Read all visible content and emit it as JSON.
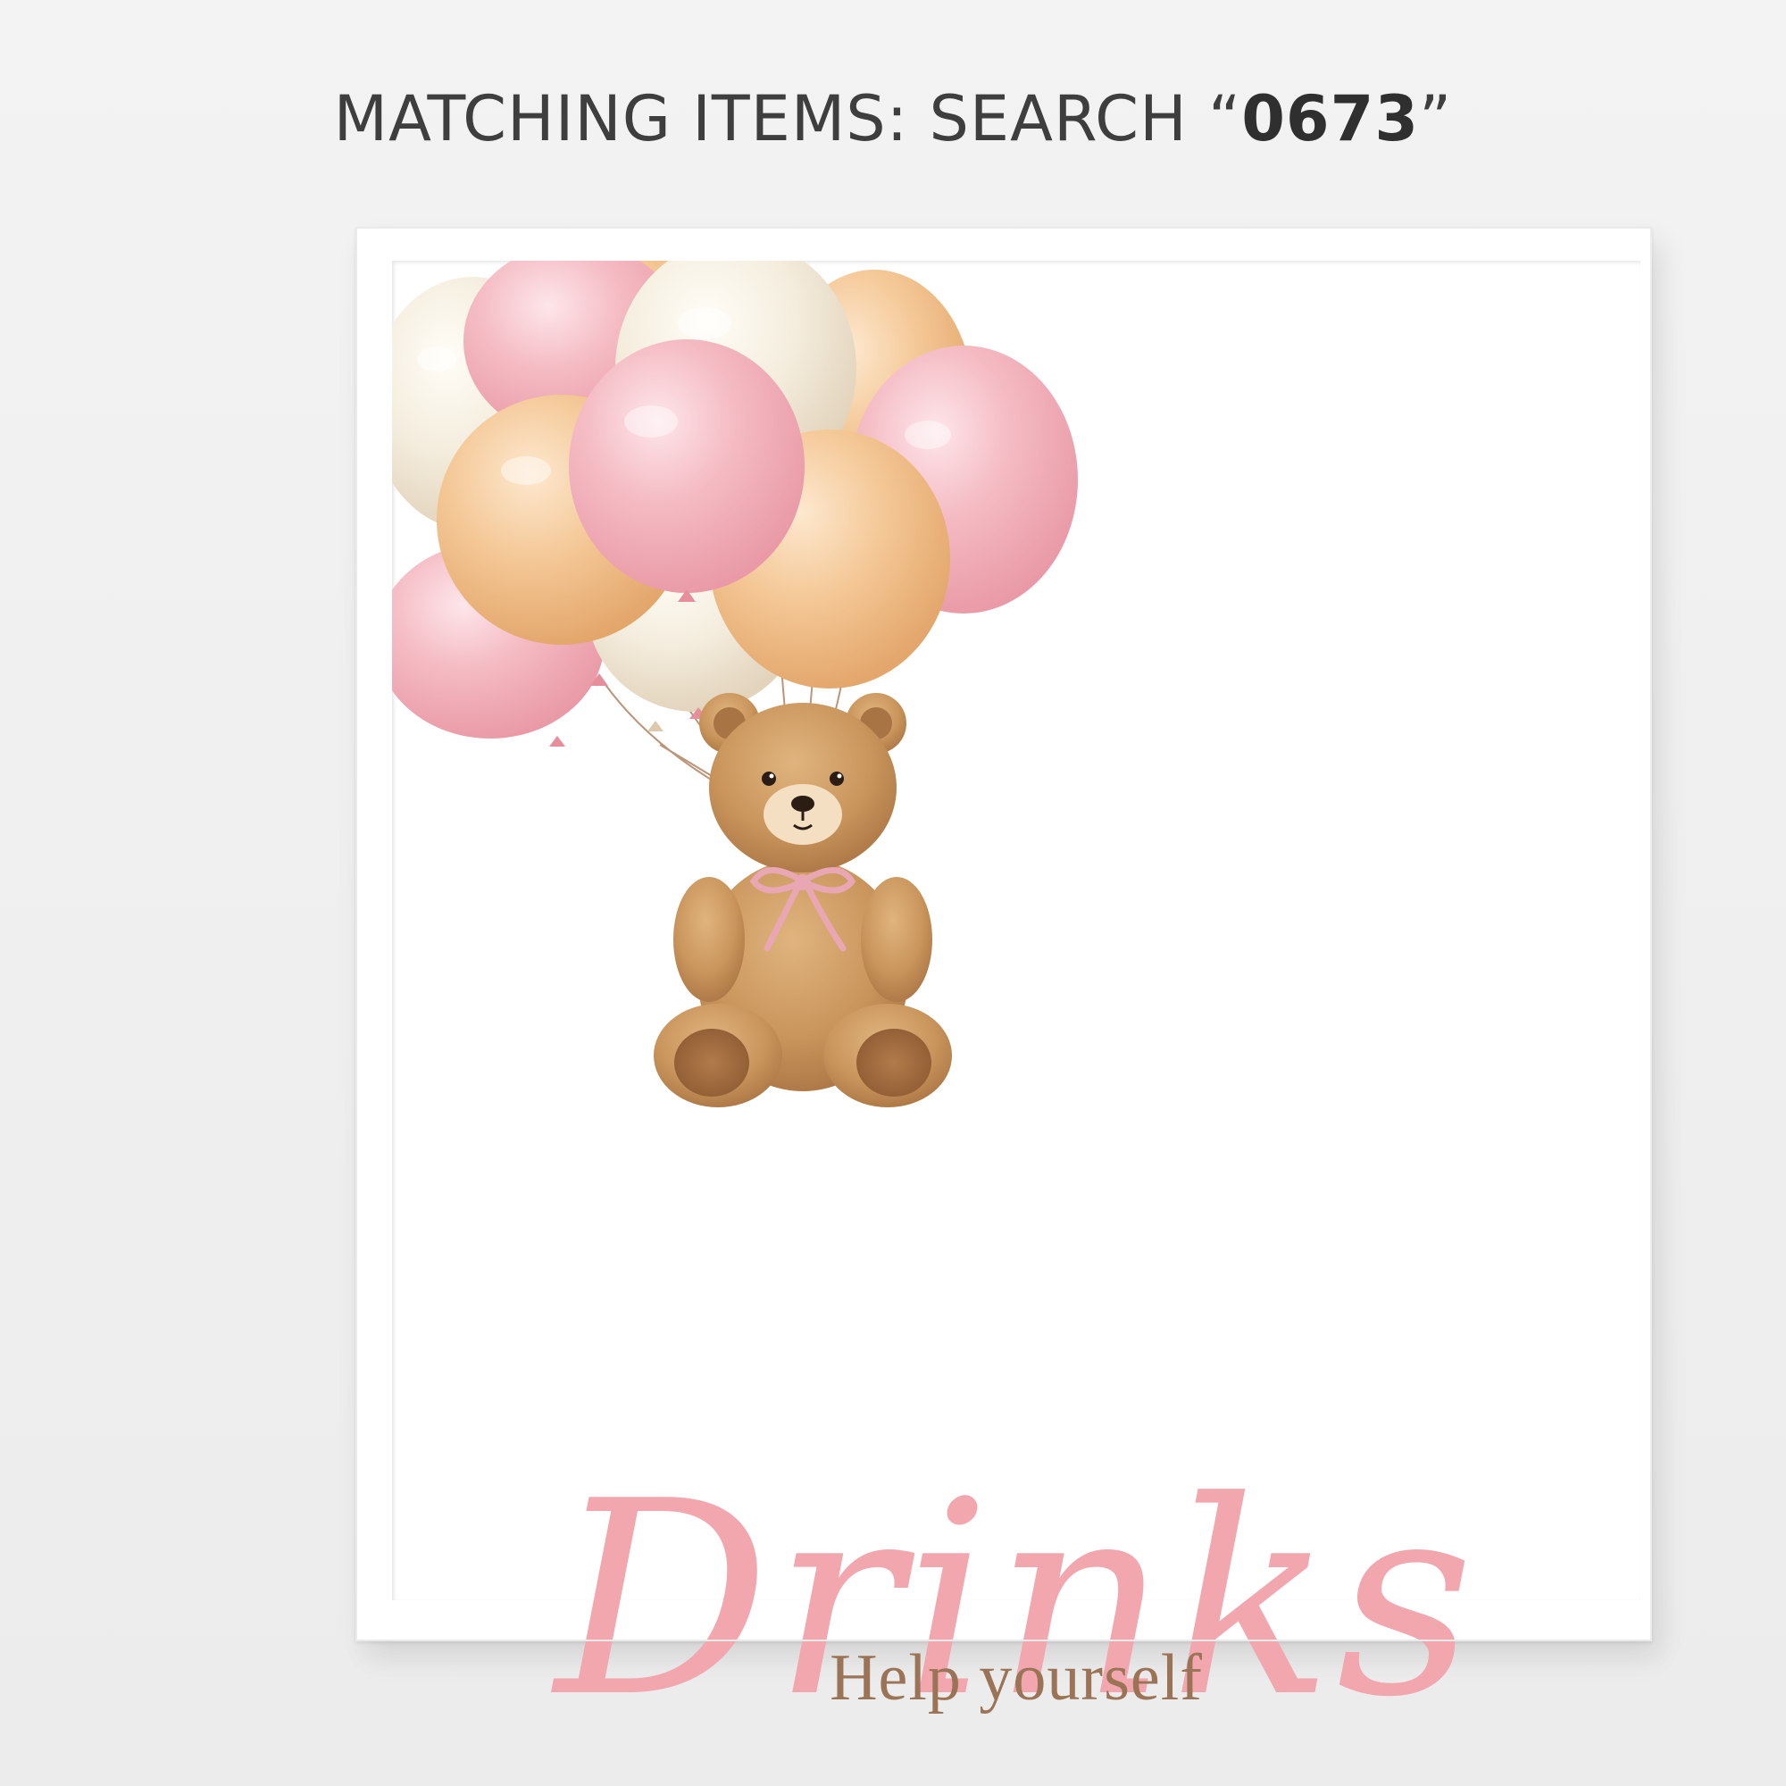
{
  "header": {
    "prefix": "MATCHING ITEMS: SEARCH “",
    "code": "0673",
    "suffix": "”"
  },
  "poster": {
    "title": "Drinks",
    "subtitle": "Help yourself",
    "title_color": "#f1a7ad",
    "subtitle_color": "#9b7356",
    "illustration": "teddy-bear-with-balloons"
  },
  "colors": {
    "background": "#efefef",
    "frame": "#ffffff",
    "balloon_pink": "#f4b6bf",
    "balloon_cream": "#f3ead8",
    "balloon_peach": "#f1c08f",
    "bear": "#c8935a"
  }
}
